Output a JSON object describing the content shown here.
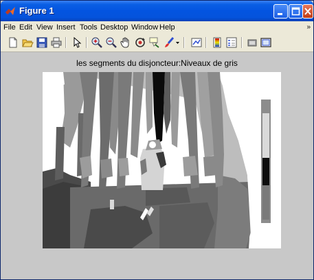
{
  "window": {
    "title": "Figure 1"
  },
  "menus": [
    "File",
    "Edit",
    "View",
    "Insert",
    "Tools",
    "Desktop",
    "Window",
    "Help"
  ],
  "menu_overflow": "»",
  "toolbar": {
    "icons": [
      "new-figure-icon",
      "open-file-icon",
      "save-figure-icon",
      "print-figure-icon",
      "edit-plot-arrow-icon",
      "zoom-in-icon",
      "zoom-out-icon",
      "pan-hand-icon",
      "rotate-3d-icon",
      "data-cursor-icon",
      "brush-icon",
      "brush-dropdown-icon",
      "link-plot-icon",
      "insert-colorbar-icon",
      "insert-legend-icon",
      "hide-plot-tools-icon",
      "show-plot-tools-icon"
    ]
  },
  "figure": {
    "title": "les segments du disjoncteur:Niveaux de gris",
    "image_kind": "grayscale segmented photograph of a circuit breaker"
  },
  "colors": {
    "titlebar": "#0354e0",
    "figure_bg": "#c8c8c8",
    "menubar_bg": "#ece9d8"
  }
}
